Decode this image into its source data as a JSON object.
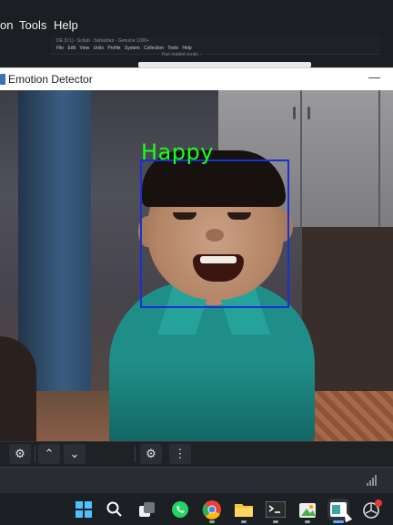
{
  "background_app": {
    "menu": [
      {
        "label": "on"
      },
      {
        "label": "Tools"
      },
      {
        "label": "Help"
      }
    ],
    "mini_window": {
      "title": "DE (0:1) · Scilab · Sebastian · Genuine 1000+",
      "menu_items": [
        "File",
        "Edit",
        "View",
        "Units",
        "Profile",
        "System Collection",
        "Tools",
        "Help"
      ],
      "status": "Run loaded script..."
    }
  },
  "window": {
    "title": "Emotion Detector",
    "minimize_glyph": "—"
  },
  "detection": {
    "label": "Happy",
    "box_color": "#1a2fd6",
    "label_color": "#1aff1a"
  },
  "toolbar": {
    "buttons": [
      {
        "name": "settings-gear-icon",
        "glyph": "⚙"
      },
      {
        "name": "chevron-up-icon",
        "glyph": "⌃"
      },
      {
        "name": "chevron-down-icon",
        "glyph": "⌄"
      },
      {
        "name": "advanced-settings-icon",
        "glyph": "⚙"
      },
      {
        "name": "more-options-icon",
        "glyph": "⋮"
      }
    ]
  },
  "taskbar": {
    "apps": [
      {
        "name": "start-icon"
      },
      {
        "name": "search-icon"
      },
      {
        "name": "task-view-icon"
      },
      {
        "name": "whatsapp-icon"
      },
      {
        "name": "chrome-icon"
      },
      {
        "name": "file-explorer-icon"
      },
      {
        "name": "terminal-icon"
      },
      {
        "name": "paint-icon"
      },
      {
        "name": "emotion-detector-app-icon"
      },
      {
        "name": "extra-app-icon"
      }
    ],
    "accent": "#60a5ff"
  }
}
